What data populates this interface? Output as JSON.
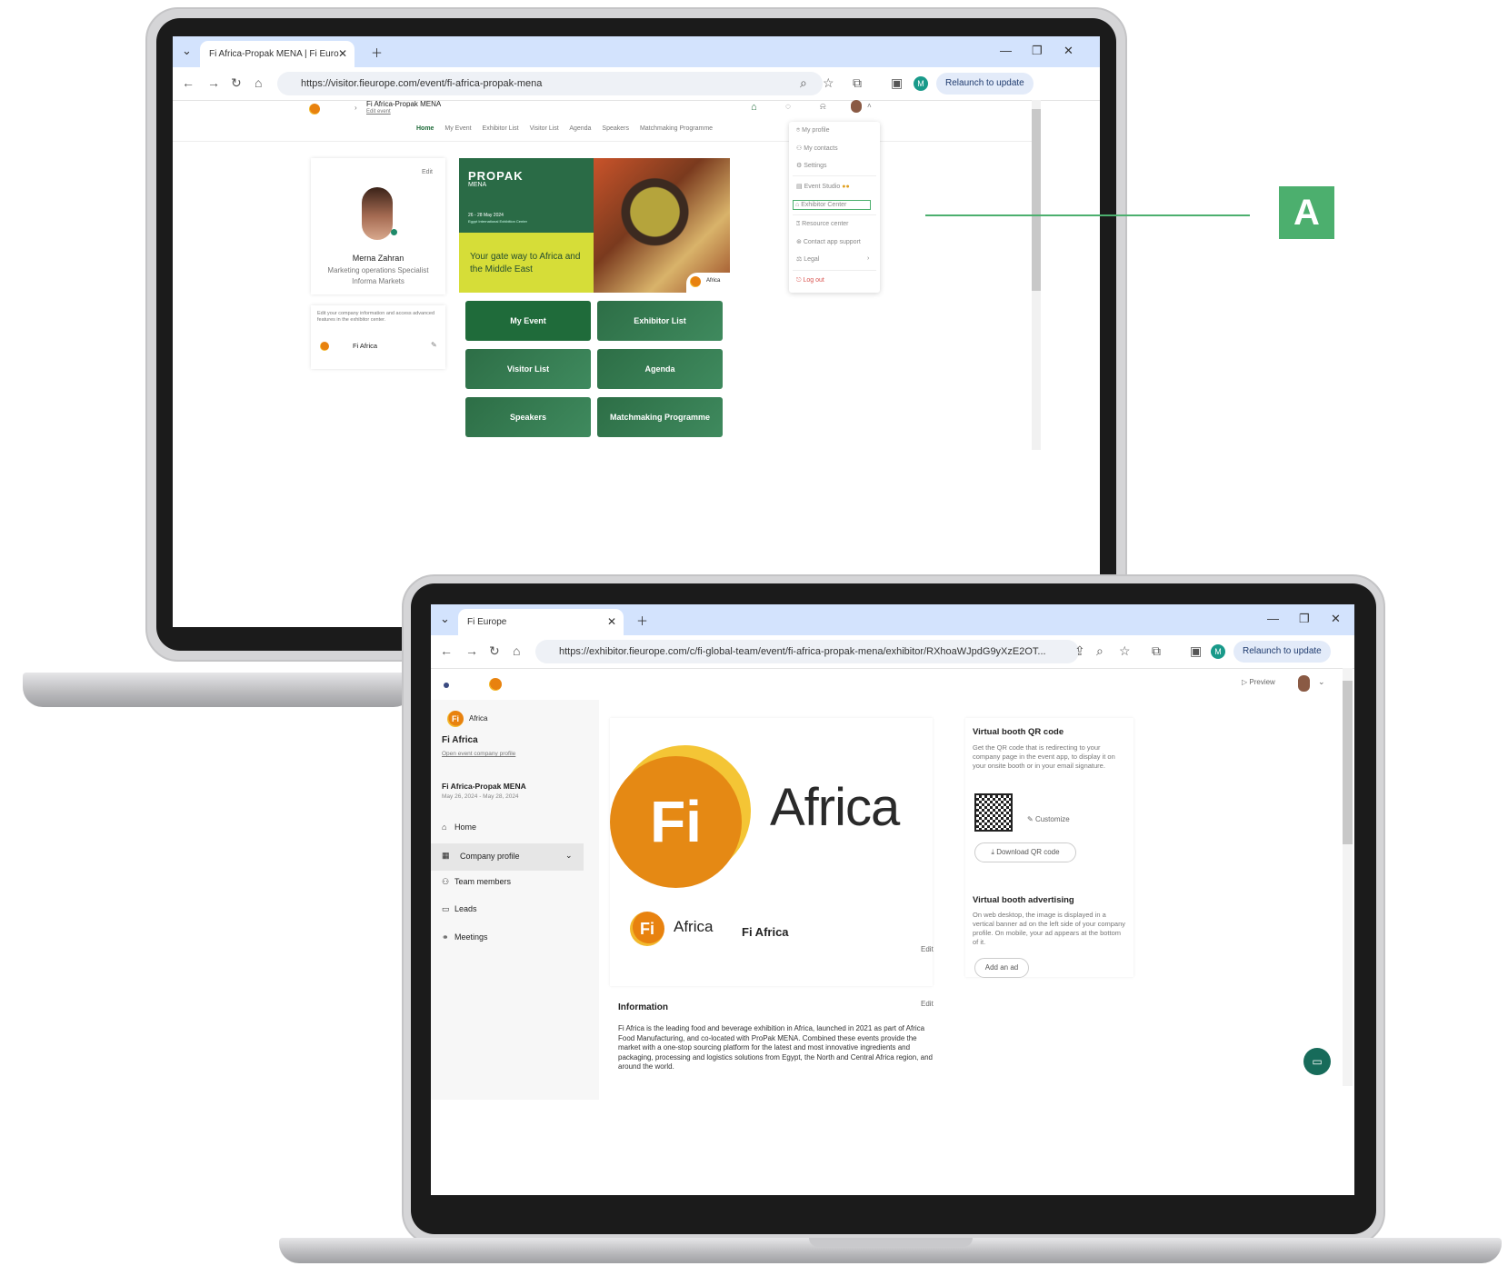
{
  "back_browser": {
    "tab_title": "Fi Africa-Propak MENA | Fi Euro",
    "url": "https://visitor.fieurope.com/event/fi-africa-propak-mena",
    "relaunch_label": "Relaunch to update",
    "profile_initial": "M",
    "event_name": "Fi Africa-Propak MENA",
    "edit_event_label": "Edit event",
    "nav_tabs": [
      "Home",
      "My Event",
      "Exhibitor List",
      "Visitor List",
      "Agenda",
      "Speakers",
      "Matchmaking Programme"
    ],
    "profile_card": {
      "edit_label": "Edit",
      "name": "Merna Zahran",
      "role": "Marketing operations Specialist",
      "company": "Informa Markets",
      "company_note": "Edit your company information and access advanced features in the exhibitor center.",
      "company_name": "Fi Africa"
    },
    "banner": {
      "brand_line1": "PROPAK",
      "brand_line2": "MENA",
      "dates": "26 - 28 May 2024",
      "venue": "Egypt International Exhibition Center",
      "tagline": "Your gate way to Africa and the Middle East",
      "badge_text": "Africa"
    },
    "tiles": [
      "My Event",
      "Exhibitor List",
      "Visitor List",
      "Agenda",
      "Speakers",
      "Matchmaking Programme"
    ],
    "dropdown": [
      "My profile",
      "My contacts",
      "Settings",
      "Event Studio",
      "Exhibitor Center",
      "Resource center",
      "Contact app support",
      "Legal",
      "Log out"
    ]
  },
  "callout": {
    "label": "A",
    "color": "#4caf6e"
  },
  "front_browser": {
    "tab_title": "Fi Europe",
    "url": "https://exhibitor.fieurope.com/c/fi-global-team/event/fi-africa-propak-mena/exhibitor/RXhoaWJpdG9yXzE2OT...",
    "relaunch_label": "Relaunch to update",
    "profile_initial": "M",
    "header": {
      "preview_label": "Preview"
    },
    "sidebar": {
      "company_badge": "Africa",
      "company_name": "Fi Africa",
      "open_profile_label": "Open event company profile",
      "event_name": "Fi Africa-Propak MENA",
      "event_dates": "May 26, 2024 - May 28, 2024",
      "items": [
        "Home",
        "Company profile",
        "Team members",
        "Leads",
        "Meetings"
      ]
    },
    "main": {
      "logo_fi": "Fi",
      "logo_word": "Africa",
      "small_logo_word": "Africa",
      "company_name": "Fi Africa",
      "edit_label": "Edit",
      "information_title": "Information",
      "information_edit": "Edit",
      "information_text": "Fi Africa is the leading food and beverage exhibition in Africa, launched in 2021 as part of Africa Food Manufacturing, and co-located with ProPak MENA. Combined these events provide the market with a one-stop sourcing platform for the latest and most innovative ingredients and packaging, processing and logistics solutions from Egypt, the North and Central Africa region, and around the world."
    },
    "right_panel": {
      "qr_title": "Virtual booth QR code",
      "qr_text": "Get the QR code that is redirecting to your company page in the event app, to display it on your onsite booth or in your email signature.",
      "customize_label": "Customize",
      "download_label": "Download QR code",
      "ad_title": "Virtual booth advertising",
      "ad_text": "On web desktop, the image is displayed in a vertical banner ad on the left side of your company profile. On mobile, your ad appears at the bottom of it.",
      "add_ad_label": "Add an ad"
    }
  }
}
